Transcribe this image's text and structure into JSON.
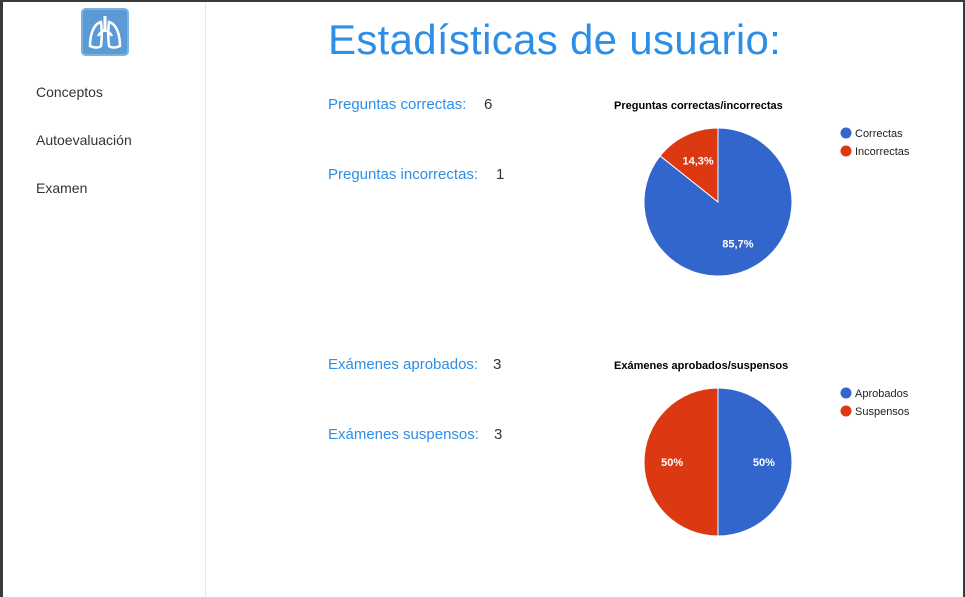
{
  "sidebar": {
    "items": [
      {
        "label": "Conceptos"
      },
      {
        "label": "Autoevaluación"
      },
      {
        "label": "Examen"
      }
    ]
  },
  "main": {
    "title": "Estadísticas de usuario:",
    "stats": [
      {
        "label": "Preguntas correctas:",
        "value": "6"
      },
      {
        "label": "Preguntas incorrectas:",
        "value": "1"
      },
      {
        "label": "Exámenes aprobados:",
        "value": "3"
      },
      {
        "label": "Exámenes suspensos:",
        "value": "3"
      }
    ]
  },
  "colors": {
    "accent": "#2d8ee6",
    "blue_slice": "#3366cc",
    "red_slice": "#dc3912"
  },
  "chart_data": [
    {
      "type": "pie",
      "title": "Preguntas correctas/incorrectas",
      "categories": [
        "Correctas",
        "Incorrectas"
      ],
      "values": [
        6,
        1
      ],
      "slice_labels": [
        "85,7%",
        "14,3%"
      ],
      "legend": "right"
    },
    {
      "type": "pie",
      "title": "Exámenes aprobados/suspensos",
      "categories": [
        "Aprobados",
        "Suspensos"
      ],
      "values": [
        3,
        3
      ],
      "slice_labels": [
        "50%",
        "50%"
      ],
      "legend": "right"
    }
  ]
}
